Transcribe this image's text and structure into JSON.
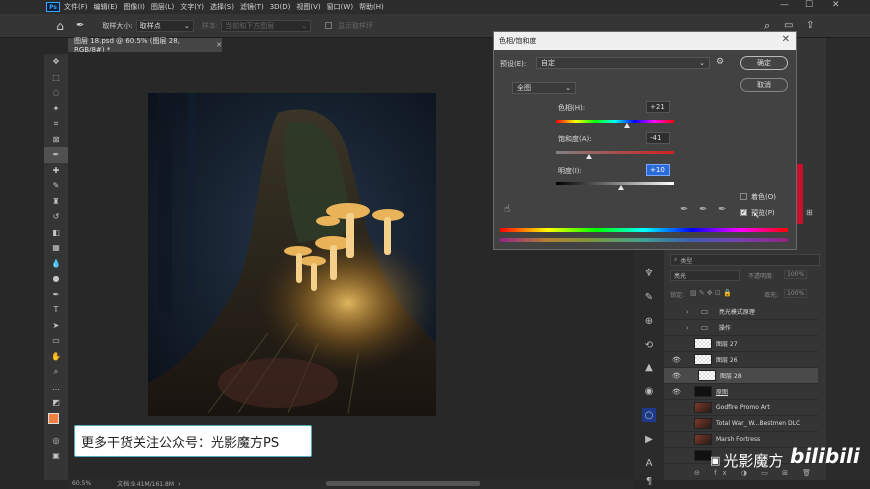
{
  "menubar": {
    "logo": "Ps",
    "items": [
      "文件(F)",
      "编辑(E)",
      "图像(I)",
      "图层(L)",
      "文字(Y)",
      "选择(S)",
      "滤镜(T)",
      "3D(D)",
      "视图(V)",
      "窗口(W)",
      "帮助(H)"
    ]
  },
  "options": {
    "sample_size_label": "取样大小:",
    "sample_size_value": "取样点",
    "sample_label": "样本:",
    "sample_value": "当前和下方图层",
    "show_ring": "显示取样环"
  },
  "document": {
    "tab_label": "图层 18.psd @ 60.5% (图层 28, RGB/8#) *",
    "zoom": "60.5%",
    "doc_info": "文档:9.41M/161.8M"
  },
  "dialog": {
    "title": "色相/饱和度",
    "preset_label": "预设(E):",
    "preset_value": "自定",
    "ok_label": "确定",
    "cancel_label": "取消",
    "channel_value": "全图",
    "hue_label": "色相(H):",
    "hue_value": "+21",
    "saturation_label": "饱和度(A):",
    "saturation_value": "-41",
    "lightness_label": "明度(I):",
    "lightness_value": "+10",
    "colorize_label": "着色(O)",
    "preview_label": "预览(P)"
  },
  "layers": {
    "search_label": "类型",
    "blend_mode": "亮光",
    "opacity_label": "不透明度:",
    "opacity_value": "100%",
    "lock_label": "锁定:",
    "fill_label": "填充:",
    "fill_value": "100%",
    "rows": [
      {
        "name": "亮光模式原理",
        "kind": "folder"
      },
      {
        "name": "操作",
        "kind": "folder"
      },
      {
        "name": "图层 27",
        "kind": "layer"
      },
      {
        "name": "图层 26",
        "kind": "layer"
      },
      {
        "name": "图层 28",
        "kind": "layer"
      },
      {
        "name": "原图",
        "kind": "image"
      },
      {
        "name": "Godfire Promo Art",
        "kind": "image"
      },
      {
        "name": "Total War_ W...Bestmen DLC",
        "kind": "image"
      },
      {
        "name": "Marsh Fortress",
        "kind": "image"
      },
      {
        "name": "",
        "kind": "dark"
      }
    ]
  },
  "overlays": {
    "promo_text": "更多干货关注公众号：光影魔方PS",
    "watermark_text": "光影魔方",
    "bilibili": "bilibili"
  }
}
